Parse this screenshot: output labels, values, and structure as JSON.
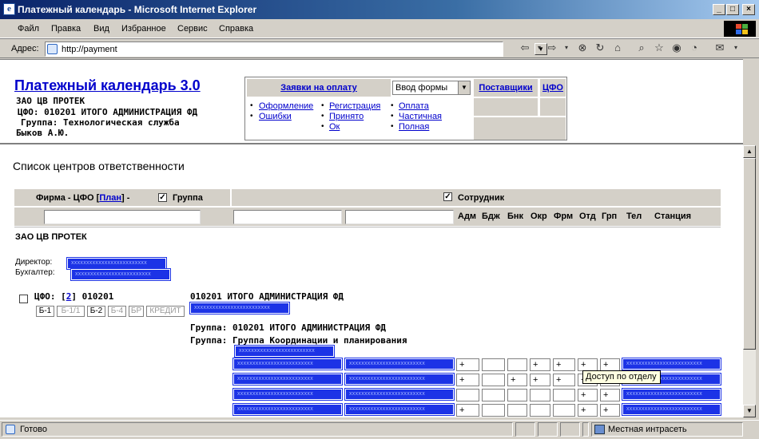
{
  "window": {
    "title": "Платежный календарь - Microsoft Internet Explorer"
  },
  "menu": [
    "Файл",
    "Правка",
    "Вид",
    "Избранное",
    "Сервис",
    "Справка"
  ],
  "address": {
    "label": "Адрес:",
    "url": "http://payment"
  },
  "header": {
    "app_title": "Платежный календарь 3.0",
    "company": "ЗАО ЦВ ПРОТЕК",
    "cfo": "ЦФО: 010201 ИТОГО АДМИНИСТРАЦИЯ ФД",
    "group": "Группа: Технологическая служба",
    "user": "Быков А.Ю."
  },
  "nav": {
    "requests_label": "Заявки на оплату",
    "form_select": "Ввод формы",
    "suppliers_label": "Поставщики",
    "cfo_label": "ЦФО",
    "col1": [
      "Оформление",
      "Ошибки"
    ],
    "col2": [
      "Регистрация",
      "Принято",
      "Ок"
    ],
    "col3": [
      "Оплата",
      "Частичная",
      "Полная"
    ]
  },
  "content": {
    "page_title": "Список центров ответственности",
    "filter": {
      "firm_label": "Фирма - ЦФО [",
      "plan_link": "План",
      "firm_label_end": "] -",
      "group_label": "Группа",
      "employee_label": "Сотрудник",
      "columns": [
        "Адм",
        "Бдж",
        "Бнк",
        "Окр",
        "Фрм",
        "Отд",
        "Грп",
        "Тел",
        "Станция"
      ]
    },
    "company": "ЗАО ЦВ ПРОТЕК",
    "director_label": "Директор:",
    "accountant_label": "Бухгалтер:",
    "cfo_entry": {
      "cfo_prefix": "ЦФО: [",
      "cfo_count": "2",
      "cfo_code": "] 010201",
      "cfo_name": "010201 ИТОГО АДМИНИСТРАЦИЯ ФД",
      "buttons": [
        "Б-1",
        "Б-1/1",
        "Б-2",
        "Б-4",
        "БР",
        "КРЕДИТ"
      ],
      "group1": "Группа: 010201 ИТОГО АДМИНИСТРАЦИЯ ФД",
      "group2": "Группа: Группа Координации и планирования"
    },
    "rows": [
      [
        "+",
        "",
        "",
        "+",
        "+",
        "+",
        "+"
      ],
      [
        "+",
        "",
        "+",
        "+",
        "+",
        "+",
        "+"
      ],
      [
        "",
        "",
        "",
        "",
        "",
        "+",
        "+"
      ],
      [
        "+",
        "",
        "",
        "",
        "",
        "+",
        "+"
      ]
    ],
    "redacted": "xxxxxxxxxxxxxxxxxxxxxxxxx",
    "tooltip": "Доступ по отделу"
  },
  "status": {
    "text": "Готово",
    "zone": "Местная интрасеть"
  }
}
